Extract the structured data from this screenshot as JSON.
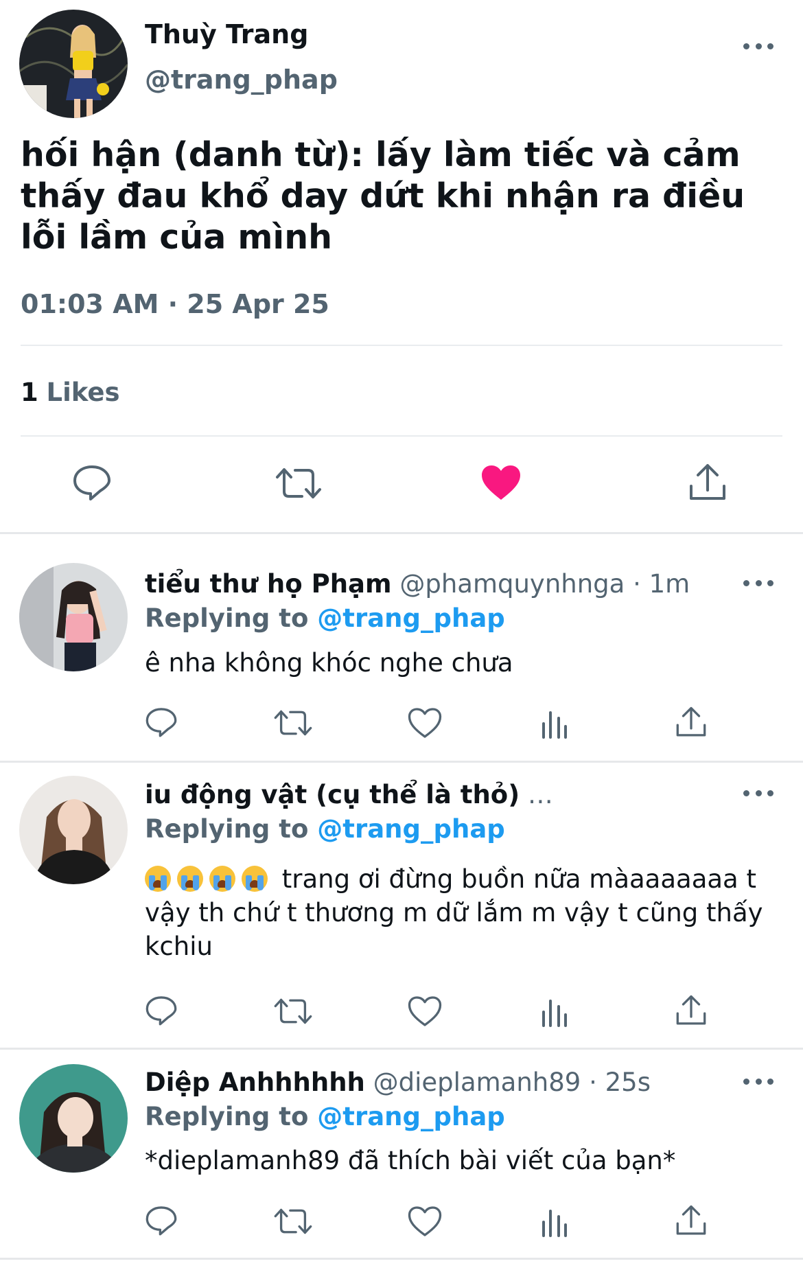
{
  "main_tweet": {
    "author_name": "Thuỳ Trang",
    "author_handle": "@trang_phap",
    "text": "hối hận (danh từ): lấy làm tiếc và cảm thấy đau khổ day dứt khi nhận ra điều lỗi lầm của mình",
    "timestamp": "01:03 AM · 25 Apr 25",
    "likes_count": "1",
    "likes_label": "Likes",
    "liked": true
  },
  "replies": [
    {
      "author_name": "tiểu thư họ Phạm",
      "meta": "@phamquynhnga · 1m",
      "replying_label": "Replying to",
      "replying_handle": "@trang_phap",
      "text": "ê nha không khóc nghe chưa"
    },
    {
      "author_name": "iu động vật (cụ thể là thỏ)",
      "meta": "…",
      "replying_label": "Replying to",
      "replying_handle": "@trang_phap",
      "emoji": "😭😭😭😭",
      "text": "trang ơi đừng buồn nữa màaaaaaaa t vậy th chứ t thương m dữ lắm m vậy t cũng thấy kchiu"
    },
    {
      "author_name": "Diệp Anhhhhhh",
      "meta": "@dieplamanh89 · 25s",
      "replying_label": "Replying to",
      "replying_handle": "@trang_phap",
      "text": "*dieplamanh89 đã thích bài viết của bạn*"
    }
  ],
  "colors": {
    "like_red": "#f91880",
    "link_blue": "#1d9bf0",
    "secondary_gray": "#536471"
  },
  "icons": [
    "more-icon",
    "reply-icon",
    "retweet-icon",
    "like-icon",
    "share-icon",
    "views-icon"
  ]
}
